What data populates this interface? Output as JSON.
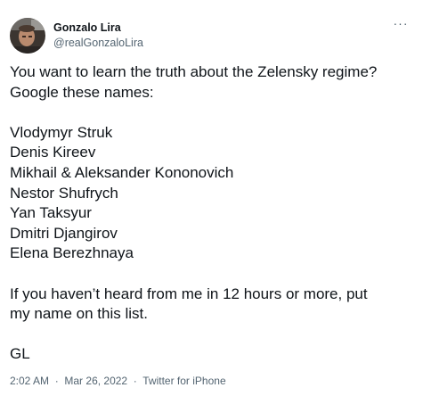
{
  "author": {
    "display_name": "Gonzalo Lira",
    "handle": "@realGonzaloLira"
  },
  "menu": {
    "more_icon": "more-horizontal-icon",
    "more_glyph": "···"
  },
  "tweet": {
    "intro": [
      "You want to learn the truth about the Zelensky regime?",
      "Google these names:"
    ],
    "names": [
      "Vlodymyr Struk",
      "Denis Kireev",
      "Mikhail & Aleksander Kononovich",
      "Nestor Shufrych",
      "Yan Taksyur",
      "Dmitri Djangirov",
      "Elena Berezhnaya"
    ],
    "closing": [
      "If you haven’t heard from me in 12 hours or more, put",
      "my name on this list."
    ],
    "signoff": "GL"
  },
  "meta": {
    "time": "2:02 AM",
    "date": "Mar 26, 2022",
    "source": "Twitter for iPhone",
    "separator": "·"
  }
}
